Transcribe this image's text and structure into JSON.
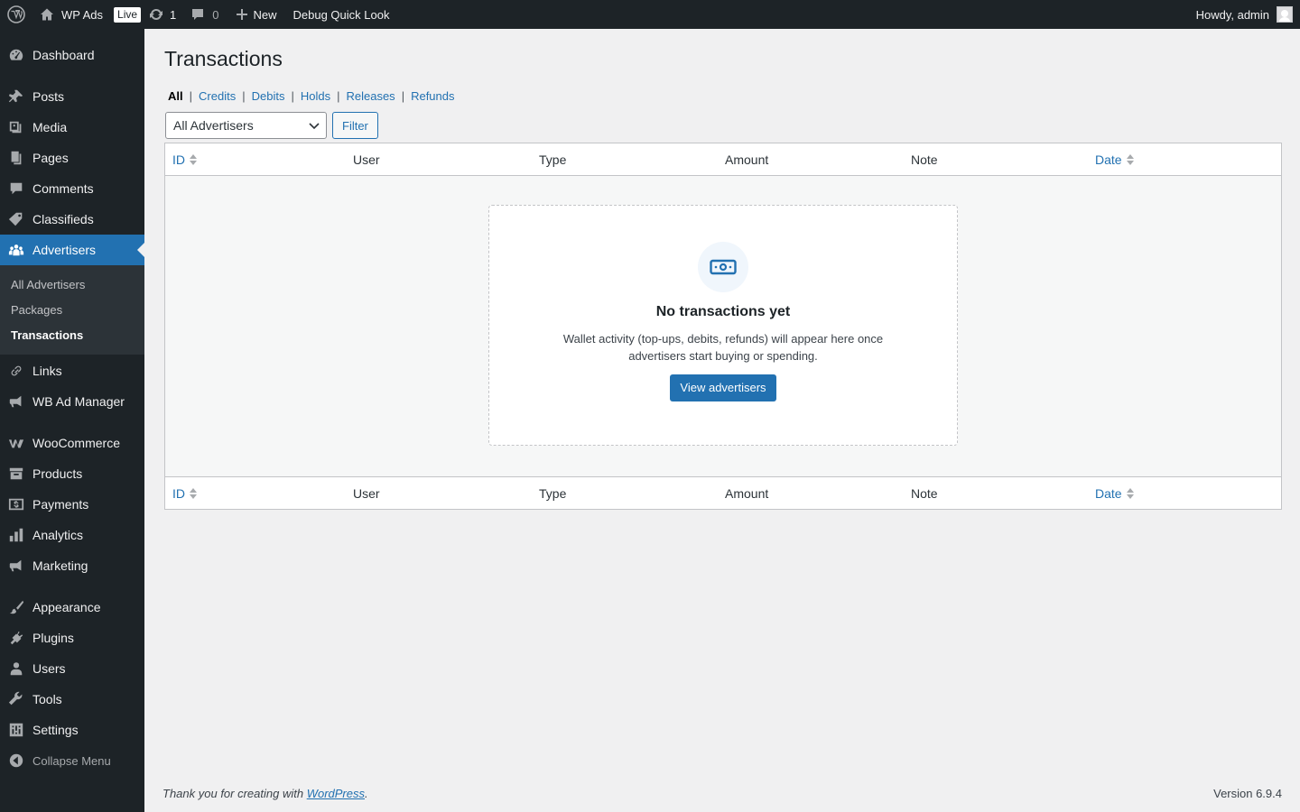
{
  "adminbar": {
    "site_name": "WP Ads",
    "live_badge": "Live",
    "updates_count": "1",
    "comments_count": "0",
    "new_label": "New",
    "debug_label": "Debug Quick Look",
    "howdy": "Howdy, admin"
  },
  "sidebar": {
    "items": [
      {
        "label": "Dashboard",
        "icon": "dashboard-icon"
      },
      {
        "label": "Posts",
        "icon": "pin-icon"
      },
      {
        "label": "Media",
        "icon": "media-icon"
      },
      {
        "label": "Pages",
        "icon": "pages-icon"
      },
      {
        "label": "Comments",
        "icon": "comment-icon"
      },
      {
        "label": "Classifieds",
        "icon": "tag-icon"
      },
      {
        "label": "Advertisers",
        "icon": "groups-icon"
      },
      {
        "label": "Links",
        "icon": "link-icon"
      },
      {
        "label": "WB Ad Manager",
        "icon": "megaphone-icon"
      },
      {
        "label": "WooCommerce",
        "icon": "woo-icon"
      },
      {
        "label": "Products",
        "icon": "archive-icon"
      },
      {
        "label": "Payments",
        "icon": "money-icon"
      },
      {
        "label": "Analytics",
        "icon": "chart-bar-icon"
      },
      {
        "label": "Marketing",
        "icon": "megaphone-icon"
      },
      {
        "label": "Appearance",
        "icon": "brush-icon"
      },
      {
        "label": "Plugins",
        "icon": "plug-icon"
      },
      {
        "label": "Users",
        "icon": "user-icon"
      },
      {
        "label": "Tools",
        "icon": "wrench-icon"
      },
      {
        "label": "Settings",
        "icon": "settings-icon"
      }
    ],
    "submenu": [
      "All Advertisers",
      "Packages",
      "Transactions"
    ],
    "collapse_label": "Collapse Menu"
  },
  "main": {
    "title": "Transactions",
    "views": [
      "All",
      "Credits",
      "Debits",
      "Holds",
      "Releases",
      "Refunds"
    ],
    "filter_select": "All Advertisers",
    "filter_button": "Filter",
    "columns": [
      "ID",
      "User",
      "Type",
      "Amount",
      "Note",
      "Date"
    ],
    "empty": {
      "title": "No transactions yet",
      "text": "Wallet activity (top-ups, debits, refunds) will appear here once advertisers start buying or spending.",
      "button": "View advertisers"
    }
  },
  "footer": {
    "thanks_prefix": "Thank you for creating with ",
    "thanks_link": "WordPress",
    "thanks_suffix": ".",
    "version": "Version 6.9.4"
  },
  "colors": {
    "accent": "#2271b1",
    "sidebar_bg": "#1d2327",
    "submenu_bg": "#2c3338",
    "page_bg": "#f0f0f1"
  }
}
